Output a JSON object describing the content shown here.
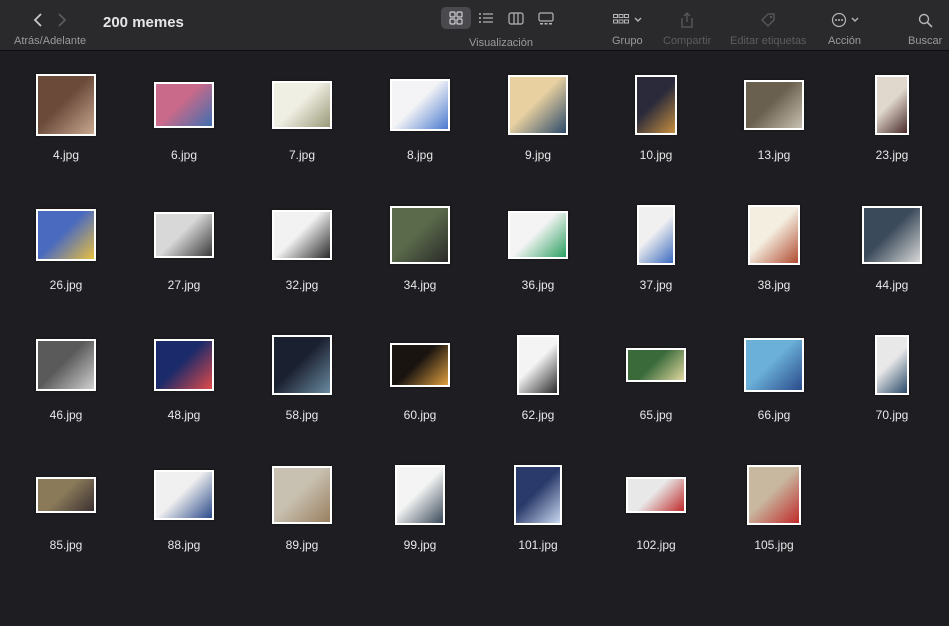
{
  "toolbar": {
    "title": "200 memes",
    "nav_label": "Atrás/Adelante",
    "view_label": "Visualización",
    "group_label": "Grupo",
    "share_label": "Compartir",
    "tags_label": "Editar etiquetas",
    "action_label": "Acción",
    "search_label": "Buscar"
  },
  "files": [
    {
      "name": "4.jpg"
    },
    {
      "name": "6.jpg"
    },
    {
      "name": "7.jpg"
    },
    {
      "name": "8.jpg"
    },
    {
      "name": "9.jpg"
    },
    {
      "name": "10.jpg"
    },
    {
      "name": "13.jpg"
    },
    {
      "name": "23.jpg"
    },
    {
      "name": "26.jpg"
    },
    {
      "name": "27.jpg"
    },
    {
      "name": "32.jpg"
    },
    {
      "name": "34.jpg"
    },
    {
      "name": "36.jpg"
    },
    {
      "name": "37.jpg"
    },
    {
      "name": "38.jpg"
    },
    {
      "name": "44.jpg"
    },
    {
      "name": "46.jpg"
    },
    {
      "name": "48.jpg"
    },
    {
      "name": "58.jpg"
    },
    {
      "name": "60.jpg"
    },
    {
      "name": "62.jpg"
    },
    {
      "name": "65.jpg"
    },
    {
      "name": "66.jpg"
    },
    {
      "name": "70.jpg"
    },
    {
      "name": "85.jpg"
    },
    {
      "name": "88.jpg"
    },
    {
      "name": "89.jpg"
    },
    {
      "name": "99.jpg"
    },
    {
      "name": "101.jpg"
    },
    {
      "name": "102.jpg"
    },
    {
      "name": "105.jpg"
    }
  ]
}
